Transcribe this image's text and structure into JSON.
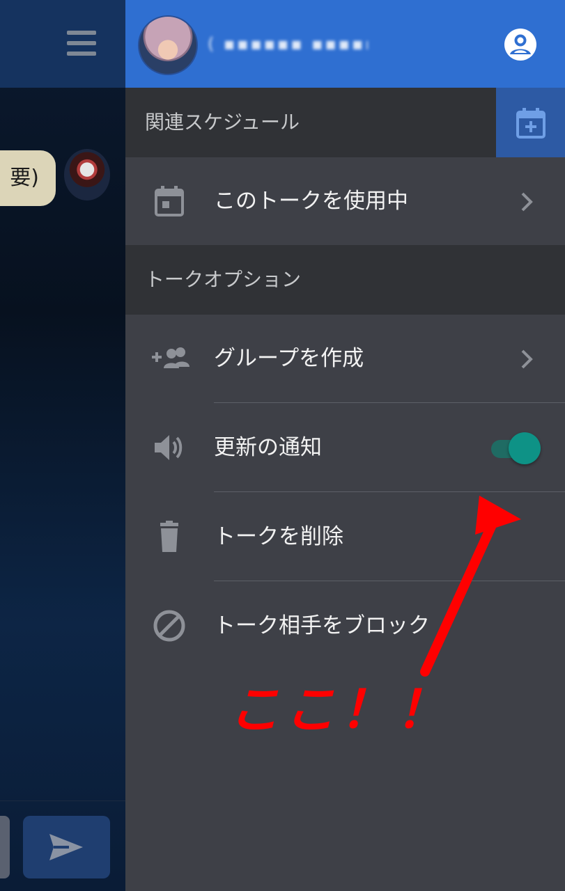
{
  "chat": {
    "bubble_text": "要)"
  },
  "drawer": {
    "user_name": "( ▪▪▪▪▪▪ ▪▪▪▪▪▪▪▪",
    "schedule_section": {
      "title": "関連スケジュール",
      "using_item": "このトークを使用中"
    },
    "talk_options_section": {
      "title": "トークオプション",
      "items": [
        {
          "label": "グループを作成",
          "icon": "add-group-icon",
          "has_chevron": true
        },
        {
          "label": "更新の通知",
          "icon": "speaker-icon",
          "toggle_on": true
        },
        {
          "label": "トークを削除",
          "icon": "trash-icon"
        },
        {
          "label": "トーク相手をブロック",
          "icon": "block-icon"
        }
      ]
    }
  },
  "annotation": {
    "text": "ここ！！",
    "color": "#ff0000"
  },
  "colors": {
    "header_blue": "#2f6fd1",
    "drawer_bg": "#3e4047",
    "section_bg": "#303236",
    "toggle_accent": "#0e9286"
  }
}
